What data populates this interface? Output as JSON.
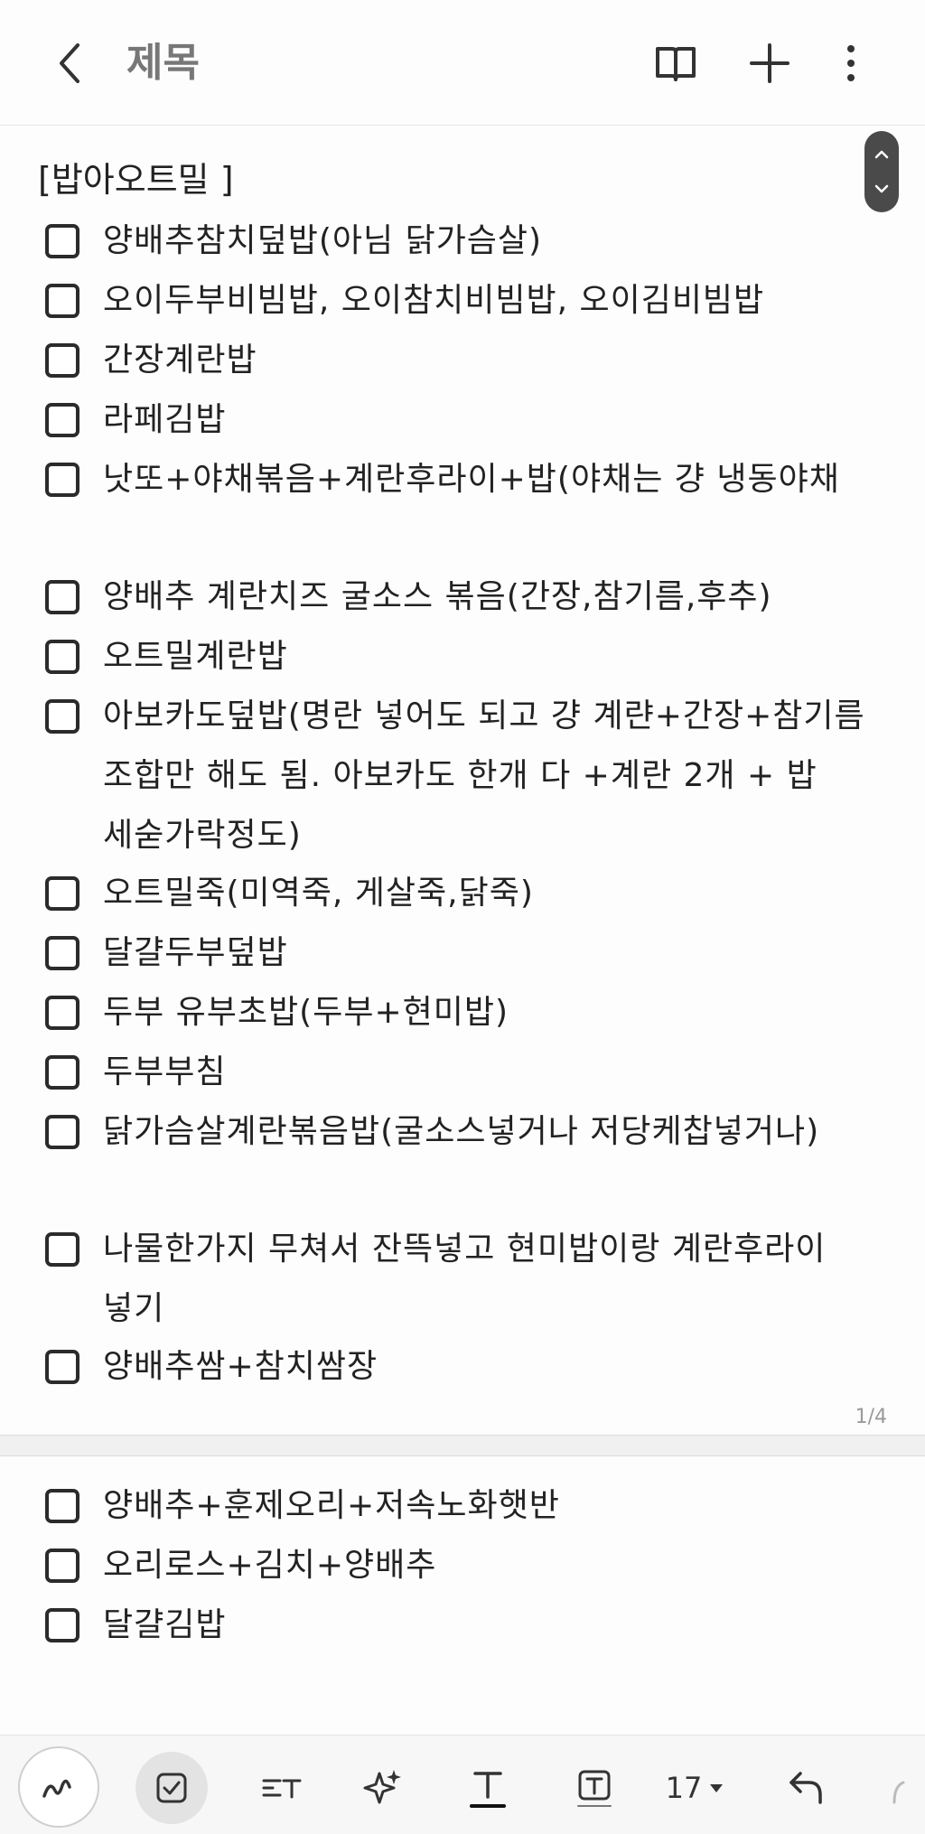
{
  "header": {
    "title": "제목"
  },
  "note": {
    "section_title": "[밥아오트밀 ]",
    "items_page1": [
      {
        "text": "양배추참치덮밥(아님 닭가슴살)"
      },
      {
        "text": "오이두부비빔밥, 오이참치비빔밥, 오이김비빔밥"
      },
      {
        "text": "간장계란밥"
      },
      {
        "text": "라페김밥"
      },
      {
        "text": "낫또+야채볶음+계란후라이+밥(야채는 걍 냉동야채"
      },
      {
        "text": "양배추 계란치즈 굴소스 볶음(간장,참기름,후추)"
      },
      {
        "text": "오트밀계란밥"
      },
      {
        "text": "아보카도덮밥(명란 넣어도 되고 걍 계랸+간장+참기름 조합만 해도 됨. 아보카도 한개 다 +계란 2개 + 밥 세숟가락정도)"
      },
      {
        "text": "오트밀죽(미역죽, 게살죽,닭죽)"
      },
      {
        "text": "달걀두부덮밥"
      },
      {
        "text": "두부 유부초밥(두부+현미밥)"
      },
      {
        "text": "두부부침"
      },
      {
        "text": "닭가슴살계란볶음밥(굴소스넣거나 저당케찹넣거나)"
      },
      {
        "text": "나물한가지 무쳐서 잔뜩넣고 현미밥이랑 계란후라이 넣기"
      },
      {
        "text": "양배추쌈+참치쌈장"
      }
    ],
    "page_indicator": "1/4",
    "items_page2": [
      {
        "text": "양배추+훈제오리+저속노화햇반"
      },
      {
        "text": "오리로스+김치+양배추"
      },
      {
        "text": "달걀김밥"
      }
    ]
  },
  "toolbar": {
    "font_size": "17"
  },
  "icons": {
    "back": "chevron-left-icon",
    "book": "book-open-icon",
    "add": "plus-icon",
    "more": "more-vertical-icon",
    "pen": "pen-icon",
    "checkbox": "checkbox-icon",
    "text_style": "text-style-icon",
    "ai": "sparkle-icon",
    "underline": "text-underline-icon",
    "text_box": "text-box-icon",
    "undo": "undo-icon"
  }
}
